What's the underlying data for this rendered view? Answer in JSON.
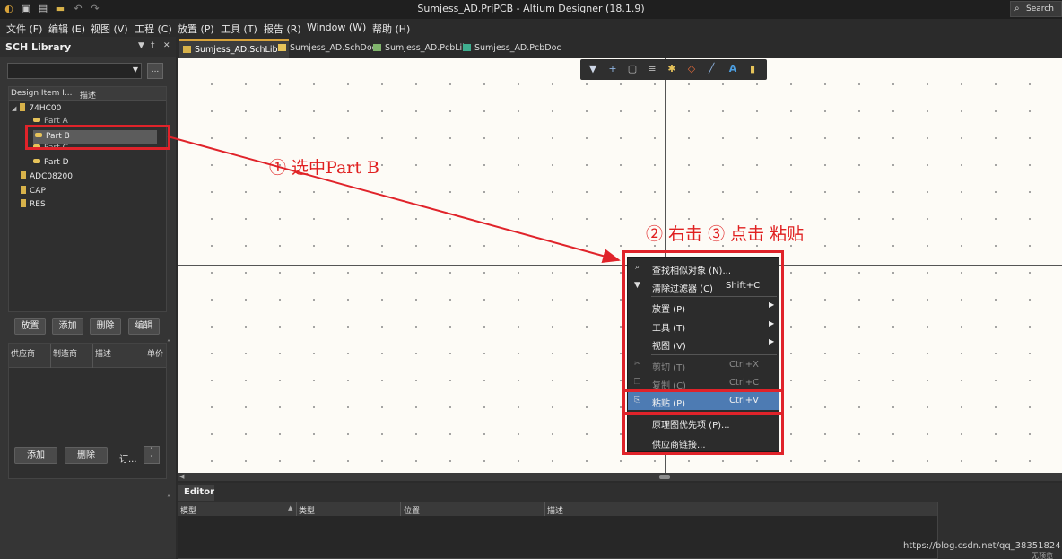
{
  "window": {
    "title": "Sumjess_AD.PrjPCB - Altium Designer (18.1.9)",
    "search_label": "Search",
    "quick_icons": [
      "app-logo-icon",
      "save-icon",
      "save-all-icon",
      "open-folder-icon",
      "undo-icon",
      "redo-icon"
    ]
  },
  "menu": [
    "文件 (F)",
    "编辑 (E)",
    "视图 (V)",
    "工程 (C)",
    "放置 (P)",
    "工具 (T)",
    "报告 (R)",
    "Window (W)",
    "帮助 (H)"
  ],
  "panel": {
    "title": "SCH Library",
    "filter_value": "",
    "filter_button": "...",
    "tree_columns": [
      "Design Item I...",
      "描述"
    ],
    "tree": [
      {
        "label": "74HC00",
        "kind": "component",
        "expanded": true
      },
      {
        "label": "Part A",
        "kind": "part"
      },
      {
        "label": "Part B",
        "kind": "part",
        "selected": true
      },
      {
        "label": "Part C",
        "kind": "part"
      },
      {
        "label": "Part D",
        "kind": "part"
      },
      {
        "label": "ADC08200",
        "kind": "component"
      },
      {
        "label": "CAP",
        "kind": "component"
      },
      {
        "label": "RES",
        "kind": "component"
      }
    ],
    "buttons": [
      "放置",
      "添加",
      "删除",
      "编辑"
    ],
    "supplier_columns": [
      "供应商",
      "制造商",
      "描述",
      "单价"
    ],
    "supplier_buttons": [
      "添加",
      "删除"
    ],
    "order_label": "订..."
  },
  "doc_tabs": [
    {
      "label": "Sumjess_AD.SchLib *",
      "active": true,
      "color": "#d8b24a"
    },
    {
      "label": "Sumjess_AD.SchDoc",
      "active": false,
      "color": "#e6c35a"
    },
    {
      "label": "Sumjess_AD.PcbLib",
      "active": false,
      "color": "#7fb36b"
    },
    {
      "label": "Sumjess_AD.PcbDoc",
      "active": false,
      "color": "#3fae8f"
    }
  ],
  "canvas_toolbar": [
    "filter-icon",
    "add-icon",
    "select-rect-icon",
    "align-icon",
    "pin-icon",
    "fill-icon",
    "line-icon",
    "text-icon",
    "part-icon"
  ],
  "annotations": {
    "step1": "① 选中Part B",
    "step23": "② 右击 ③ 点击 粘贴"
  },
  "context_menu": [
    {
      "label": "查找相似对象 (N)...",
      "shortcut": "",
      "icon": "search-icon",
      "submenu": false,
      "enabled": true
    },
    {
      "label": "清除过滤器 (C)",
      "shortcut": "Shift+C",
      "icon": "clear-filter-icon",
      "submenu": false,
      "enabled": true
    },
    {
      "label": "放置 (P)",
      "shortcut": "",
      "icon": "",
      "submenu": true,
      "enabled": true
    },
    {
      "label": "工具 (T)",
      "shortcut": "",
      "icon": "",
      "submenu": true,
      "enabled": true
    },
    {
      "label": "视图 (V)",
      "shortcut": "",
      "icon": "",
      "submenu": true,
      "enabled": true
    },
    {
      "label": "剪切 (T)",
      "shortcut": "Ctrl+X",
      "icon": "cut-icon",
      "submenu": false,
      "enabled": false
    },
    {
      "label": "复制 (C)",
      "shortcut": "Ctrl+C",
      "icon": "copy-icon",
      "submenu": false,
      "enabled": false
    },
    {
      "label": "粘贴 (P)",
      "shortcut": "Ctrl+V",
      "icon": "paste-icon",
      "submenu": false,
      "enabled": true,
      "highlighted": true
    },
    {
      "label": "原理图优先项 (P)...",
      "shortcut": "",
      "icon": "",
      "submenu": false,
      "enabled": true
    },
    {
      "label": "供应商链接...",
      "shortcut": "",
      "icon": "",
      "submenu": false,
      "enabled": true
    }
  ],
  "editor": {
    "tab": "Editor",
    "columns": [
      "模型",
      "类型",
      "位置",
      "描述"
    ]
  },
  "watermark": "https://blog.csdn.net/qq_38351824",
  "corner_text": "无预览",
  "colors": {
    "highlight": "#4d7bb3",
    "annotation_red": "#e0232a",
    "canvas_bg": "#fdfbf6"
  }
}
